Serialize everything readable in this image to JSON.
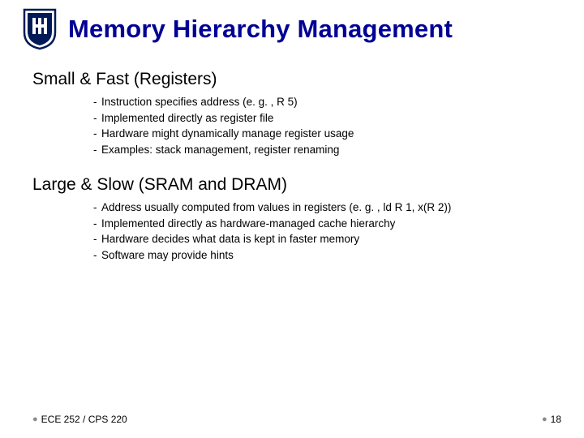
{
  "title": "Memory Hierarchy Management",
  "sections": [
    {
      "heading": "Small & Fast (Registers)",
      "items": [
        "Instruction specifies address (e. g. , R 5)",
        "Implemented directly as register file",
        "Hardware might dynamically manage register usage",
        "Examples: stack management, register renaming"
      ]
    },
    {
      "heading": "Large & Slow (SRAM and DRAM)",
      "items": [
        "Address usually computed from values in registers (e. g. , ld R 1, x(R 2))",
        "Implemented directly as hardware-managed cache hierarchy",
        "Hardware decides what data is kept in faster memory",
        "Software may provide hints"
      ]
    }
  ],
  "footer": {
    "course": "ECE 252 / CPS 220",
    "page": "18"
  }
}
